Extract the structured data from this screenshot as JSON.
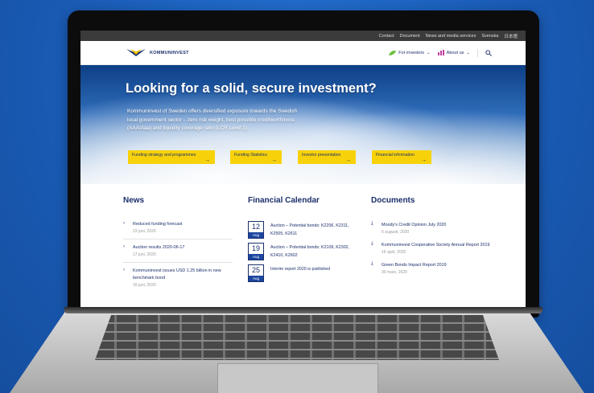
{
  "topbar": {
    "links": [
      "Contact",
      "Document",
      "News and media services",
      "Svenska",
      "日本語"
    ]
  },
  "header": {
    "logo_text": "KOMMUNINVEST",
    "nav": [
      {
        "label": "For investors",
        "icon": "leaf-icon"
      },
      {
        "label": "About us",
        "icon": "chart-icon"
      }
    ],
    "search_icon": "search-icon"
  },
  "hero": {
    "title": "Looking for a solid, secure investment?",
    "body": "Kommuninvest of Sweden offers diversified exposure towards the Swedish local government sector – zero risk weight, best possible creditworthiness (AAA/Aaa) and liquidity coverage ratio (LCR Level 1).",
    "buttons": [
      "Funding strategy and programmes",
      "Funding Statistics",
      "Investor presentation",
      "Financial information"
    ]
  },
  "news": {
    "heading": "News",
    "items": [
      {
        "title": "Reduced funding forecast",
        "date": "23 juni, 2020"
      },
      {
        "title": "Auction results 2020-06-17",
        "date": "17 juni, 2020"
      },
      {
        "title": "Kommuninvest issues USD 1.25 billion in new benchmark bond",
        "date": "16 juni, 2020"
      }
    ]
  },
  "calendar": {
    "heading": "Financial Calendar",
    "items": [
      {
        "day": "12",
        "month": "Aug",
        "text": "Auction – Potential bonds: K2206, K2311, K2505, K2611"
      },
      {
        "day": "19",
        "month": "Aug",
        "text": "Auction – Potential bonds: K2109, K2302, K2410, K2602"
      },
      {
        "day": "25",
        "month": "Aug",
        "text": "Interim report 2020 is published"
      }
    ]
  },
  "documents": {
    "heading": "Documents",
    "items": [
      {
        "title": "Moody's Credit Opinion July 2020",
        "date": "6 augusti, 2020"
      },
      {
        "title": "Kommuninvest Cooperative Society Annual Report 2019",
        "date": "16 april, 2020"
      },
      {
        "title": "Green Bonds Impact Report 2019",
        "date": "30 mars, 2020"
      }
    ]
  },
  "colors": {
    "background": "#1a5bb5",
    "brand_navy": "#1b2f6b",
    "button_yellow": "#f7d20a",
    "topbar": "#3b3b3b"
  }
}
